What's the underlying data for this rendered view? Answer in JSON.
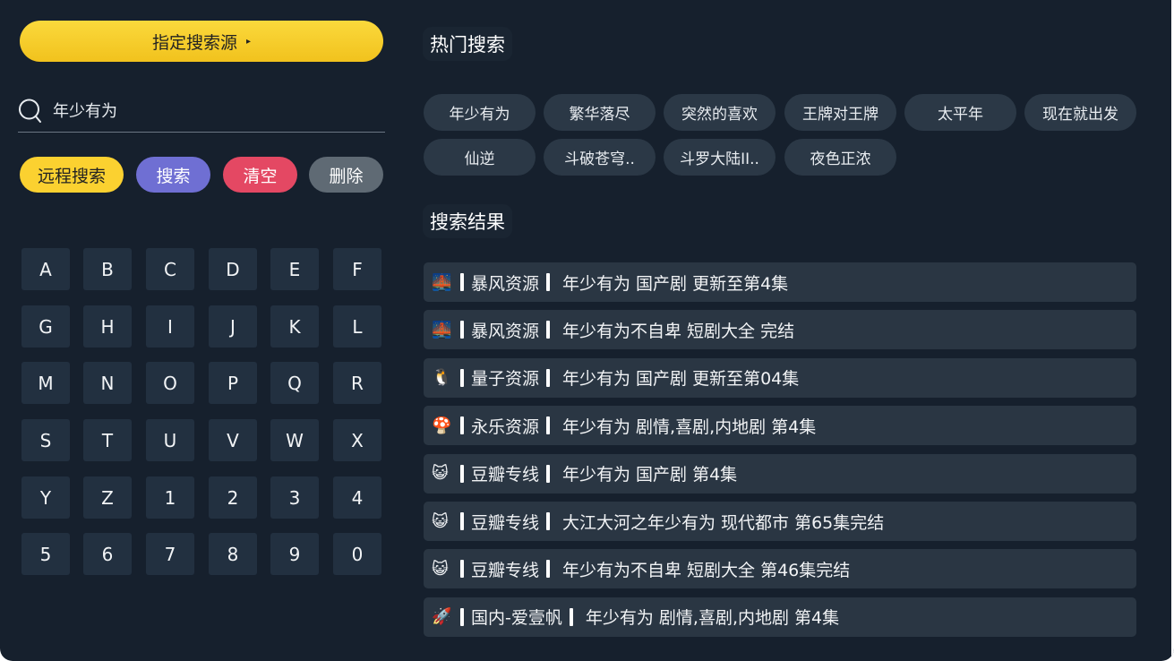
{
  "left": {
    "source_button": {
      "label": "指定搜索源",
      "arrow": "▸"
    },
    "search_value": "年少有为",
    "actions": {
      "remote": "远程搜索",
      "search": "搜索",
      "clear": "清空",
      "delete": "删除"
    },
    "keys": [
      "A",
      "B",
      "C",
      "D",
      "E",
      "F",
      "G",
      "H",
      "I",
      "J",
      "K",
      "L",
      "M",
      "N",
      "O",
      "P",
      "Q",
      "R",
      "S",
      "T",
      "U",
      "V",
      "W",
      "X",
      "Y",
      "Z",
      "1",
      "2",
      "3",
      "4",
      "5",
      "6",
      "7",
      "8",
      "9",
      "0"
    ]
  },
  "hot": {
    "title": "热门搜索",
    "chips": [
      "年少有为",
      "繁华落尽",
      "突然的喜欢",
      "王牌对王牌",
      "太平年",
      "现在就出发",
      "仙逆",
      "斗破苍穹..",
      "斗罗大陆II..",
      "夜色正浓"
    ]
  },
  "results": {
    "title": "搜索结果",
    "items": [
      {
        "icon": "🌉",
        "source": "暴风资源",
        "text": "年少有为 国产剧 更新至第4集"
      },
      {
        "icon": "🌉",
        "source": "暴风资源",
        "text": "年少有为不自卑 短剧大全 完结"
      },
      {
        "icon": "🐧",
        "source": "量子资源",
        "text": "年少有为 国产剧 更新至第04集"
      },
      {
        "icon": "🍄",
        "source": "永乐资源",
        "text": "年少有为 剧情,喜剧,内地剧 第4集"
      },
      {
        "icon": "😺",
        "source": "豆瓣专线",
        "text": "年少有为 国产剧 第4集"
      },
      {
        "icon": "😺",
        "source": "豆瓣专线",
        "text": "大江大河之年少有为 现代都市 第65集完结"
      },
      {
        "icon": "😺",
        "source": "豆瓣专线",
        "text": "年少有为不自卑 短剧大全 第46集完结"
      },
      {
        "icon": "🚀",
        "source": "国内-爱壹帆",
        "text": "年少有为 剧情,喜剧,内地剧 第4集"
      }
    ]
  },
  "colors": {
    "background": "#16202d",
    "accent_yellow": "#fbd130",
    "search_purple": "#6f6fd3",
    "clear_red": "#e44863",
    "delete_gray": "#5f6a74"
  }
}
